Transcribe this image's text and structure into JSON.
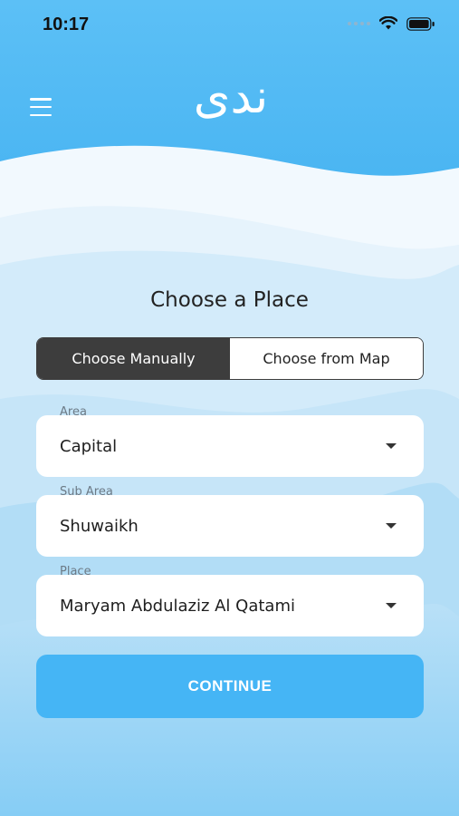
{
  "status_bar": {
    "time": "10:17"
  },
  "header": {
    "logo_text": "ندى",
    "menu_icon": "hamburger-menu-icon"
  },
  "main": {
    "title": "Choose a Place",
    "tabs": [
      {
        "label": "Choose Manually",
        "active": true
      },
      {
        "label": "Choose from Map",
        "active": false
      }
    ],
    "fields": {
      "area": {
        "label": "Area",
        "value": "Capital"
      },
      "sub_area": {
        "label": "Sub Area",
        "value": "Shuwaikh"
      },
      "place": {
        "label": "Place",
        "value": "Maryam Abdulaziz Al Qatami"
      }
    },
    "continue_label": "CONTINUE"
  },
  "colors": {
    "header_blue": "#4fb8f3",
    "active_tab": "#3d3d3d",
    "button_blue": "#45b5f5"
  }
}
